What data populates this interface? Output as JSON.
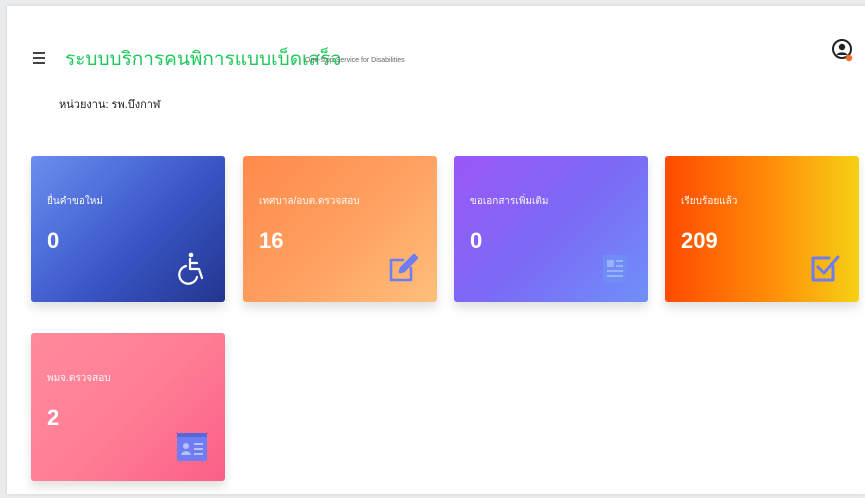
{
  "header": {
    "title": "ระบบบริการคนพิการแบบเบ็ดเสร็จ",
    "subtitle": "One-stop Service for Disabilities",
    "agency_label": "หน่วยงาน:",
    "agency_value": "รพ.บึงกาฬ"
  },
  "cards": [
    {
      "label": "ยื่นคำขอใหม่",
      "value": "0",
      "icon": "wheelchair-icon",
      "icon_color": "#ffffff"
    },
    {
      "label": "เทศบาล/อบต.ตรวจสอบ",
      "value": "16",
      "icon": "edit-icon",
      "icon_color": "#6f7df2"
    },
    {
      "label": "ขอเอกสารเพิ่มเติม",
      "value": "0",
      "icon": "document-icon",
      "icon_color": "#6f8cf7"
    },
    {
      "label": "เรียบร้อยแล้ว",
      "value": "209",
      "icon": "checkbox-icon",
      "icon_color": "#6f7df2"
    },
    {
      "label": "พมจ.ตรวจสอบ",
      "value": "2",
      "icon": "id-card-icon",
      "icon_color": "#6f7df2"
    }
  ]
}
